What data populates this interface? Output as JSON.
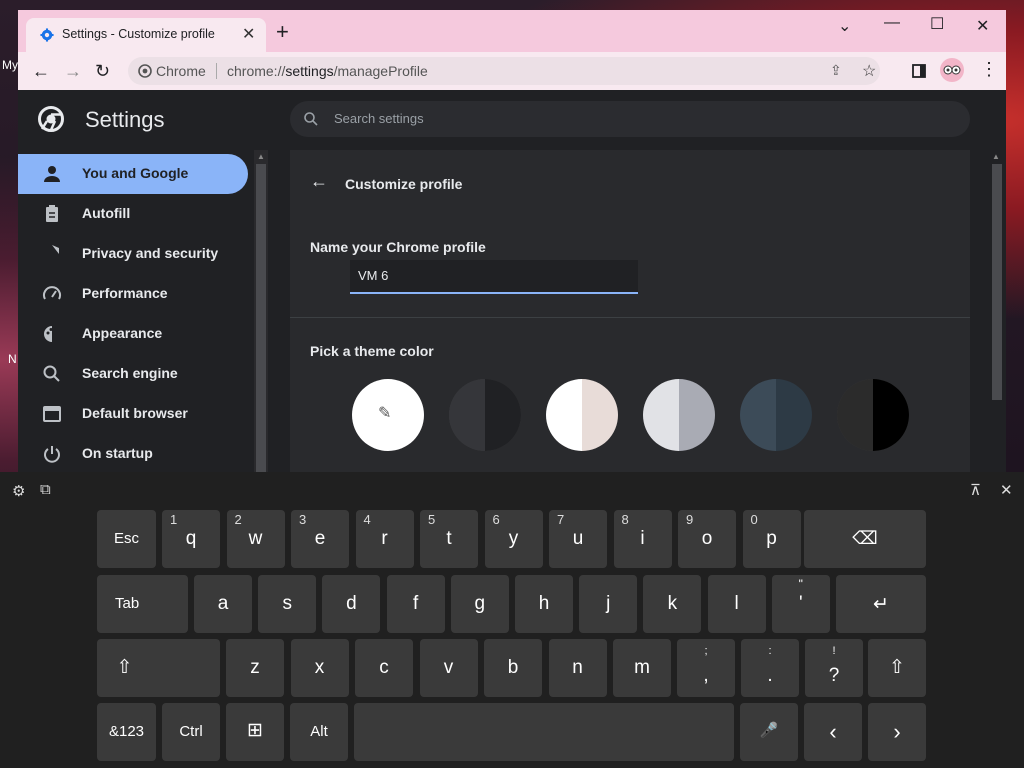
{
  "desktop": {
    "frag1": "My",
    "frag2": "N"
  },
  "tab": {
    "title": "Settings - Customize profile",
    "close": "✕"
  },
  "window_controls": {
    "dropdown": "⌄",
    "minimize": "—",
    "maximize": "☐",
    "close": "✕"
  },
  "omnibox": {
    "site_label": "Chrome",
    "url_scheme": "chrome://",
    "url_path": "settings",
    "url_rest": "/manageProfile"
  },
  "settings": {
    "title": "Settings",
    "search_placeholder": "Search settings",
    "sidebar": [
      {
        "label": "You and Google",
        "icon": "person-icon",
        "active": true
      },
      {
        "label": "Autofill",
        "icon": "clipboard-icon"
      },
      {
        "label": "Privacy and security",
        "icon": "shield-icon"
      },
      {
        "label": "Performance",
        "icon": "speedometer-icon"
      },
      {
        "label": "Appearance",
        "icon": "palette-icon"
      },
      {
        "label": "Search engine",
        "icon": "search-icon"
      },
      {
        "label": "Default browser",
        "icon": "browser-icon"
      },
      {
        "label": "On startup",
        "icon": "power-icon"
      }
    ],
    "page_title": "Customize profile",
    "name_heading": "Name your Chrome profile",
    "profile_name": "VM 6",
    "theme_heading": "Pick a theme color",
    "swatches": [
      {
        "name": "custom-color",
        "left": "#ffffff",
        "right": "#ffffff"
      },
      {
        "name": "grey-dark",
        "left": "#35363a",
        "right": "#202124"
      },
      {
        "name": "beige",
        "left": "#ffffff",
        "right": "#e8dcd8"
      },
      {
        "name": "light-grey",
        "left": "#e1e2e6",
        "right": "#a9abb4"
      },
      {
        "name": "slate",
        "left": "#3c4b58",
        "right": "#2d3a45"
      },
      {
        "name": "black",
        "left": "#2b2b2b",
        "right": "#000000"
      }
    ]
  },
  "keyboard": {
    "row1": [
      "Esc",
      "q",
      "w",
      "e",
      "r",
      "t",
      "y",
      "u",
      "i",
      "o",
      "p"
    ],
    "row1_alt": [
      "",
      "1",
      "2",
      "3",
      "4",
      "5",
      "6",
      "7",
      "8",
      "9",
      "0"
    ],
    "row2": [
      "Tab",
      "a",
      "s",
      "d",
      "f",
      "g",
      "h",
      "j",
      "k",
      "l",
      "'"
    ],
    "row2_alt_quote": "\"",
    "row3": [
      "z",
      "x",
      "c",
      "v",
      "b",
      "n",
      "m"
    ],
    "row3_punct": [
      {
        "main": ",",
        "alt": ";"
      },
      {
        "main": ".",
        "alt": ":"
      },
      {
        "main": "?",
        "alt": "!"
      }
    ],
    "row4": {
      "sym": "&123",
      "ctrl": "Ctrl",
      "alt": "Alt"
    },
    "icons": {
      "backspace": "⌫",
      "enter": "↵",
      "shift": "⇧",
      "mic": "🎤",
      "left": "‹",
      "right": "›",
      "win": "⊞",
      "settings": "⚙",
      "dock": "⊼",
      "close": "✕"
    }
  }
}
